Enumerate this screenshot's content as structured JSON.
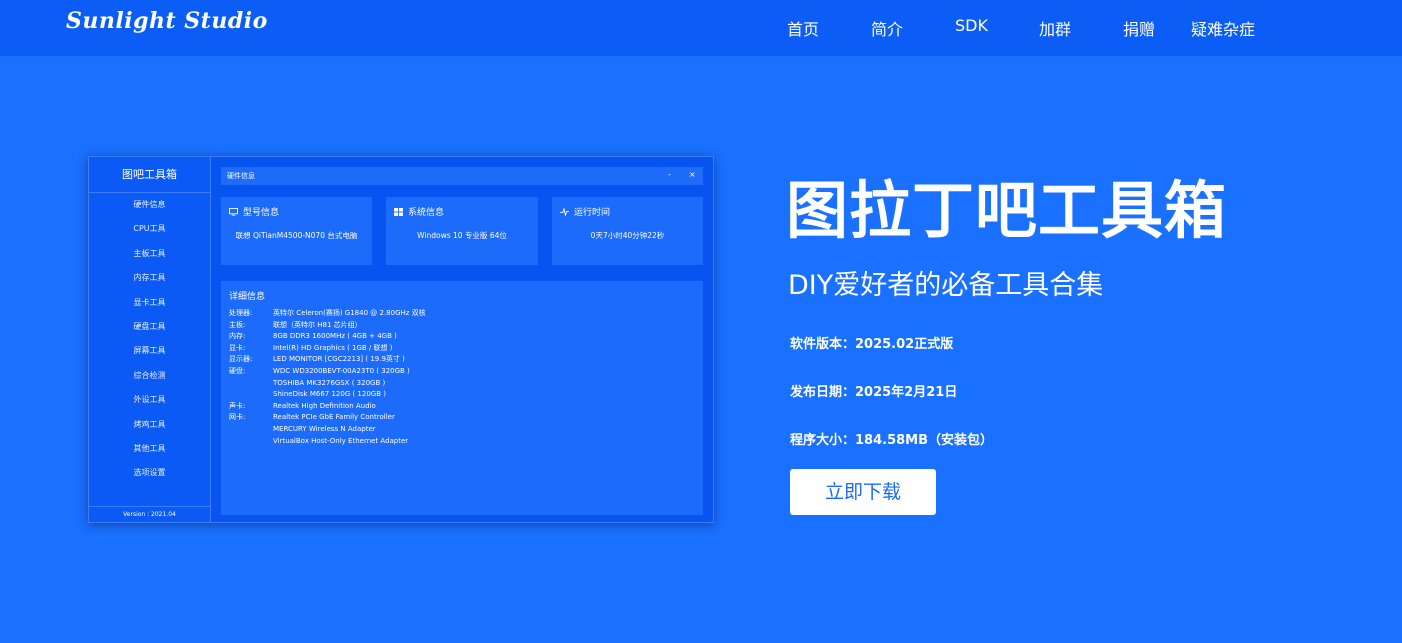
{
  "header": {
    "logo": "Sunlight Studio",
    "nav": [
      "首页",
      "简介",
      "SDK",
      "加群",
      "捐赠",
      "疑难杂症"
    ]
  },
  "app": {
    "side_title": "图吧工具箱",
    "side_items": [
      "硬件信息",
      "CPU工具",
      "主板工具",
      "内存工具",
      "显卡工具",
      "硬盘工具",
      "屏幕工具",
      "综合检测",
      "外设工具",
      "烤鸡工具",
      "其他工具",
      "选项设置"
    ],
    "version": "Version : 2021.04",
    "window_title": "硬件信息",
    "win_min": "-",
    "win_close": "×",
    "cards": [
      {
        "title": "型号信息",
        "value": "联想 QiTianM4500-N070 台式电脑",
        "icon": "monitor-icon"
      },
      {
        "title": "系统信息",
        "value": "Windows 10 专业版 64位",
        "icon": "windows-icon"
      },
      {
        "title": "运行时间",
        "value": "0天7小时40分钟22秒",
        "icon": "pulse-icon"
      }
    ],
    "detail_title": "详细信息",
    "detail_rows": [
      {
        "k": "处理器:",
        "v": "英特尔 Celeron(赛扬) G1840 @ 2.80GHz 双核"
      },
      {
        "k": "主板:",
        "v": "联想（英特尔 H81 芯片组）"
      },
      {
        "k": "内存:",
        "v": "8GB DDR3 1600MHz ( 4GB + 4GB )"
      },
      {
        "k": "显卡:",
        "v": "Intel(R) HD Graphics ( 1GB / 联想 )"
      },
      {
        "k": "显示器:",
        "v": "LED MONITOR [CGC2213] ( 19.9英寸 )"
      },
      {
        "k": "硬盘:",
        "v": "WDC WD3200BEVT-00A23T0 ( 320GB )"
      },
      {
        "k": "",
        "v": "TOSHIBA MK3276GSX ( 320GB )"
      },
      {
        "k": "",
        "v": "ShineDisk M667 120G ( 120GB )"
      },
      {
        "k": "声卡:",
        "v": "Realtek High Definition Audio"
      },
      {
        "k": "网卡:",
        "v": "Realtek PCIe GbE Family Controller"
      },
      {
        "k": "",
        "v": "MERCURY Wireless N Adapter"
      },
      {
        "k": "",
        "v": "VirtualBox Host-Only Ethernet Adapter"
      }
    ]
  },
  "hero": {
    "title": "图拉丁吧工具箱",
    "subtitle": "DIY爱好者的必备工具合集",
    "version": "软件版本：2025.02正式版",
    "date": "发布日期：2025年2月21日",
    "size": "程序大小：184.58MB（安装包）",
    "download": "立即下载"
  },
  "colors": {
    "background": "#1a70ff",
    "header": "#0b5df5",
    "app_bg": "#0854f0",
    "button_text": "#1a6cf6"
  }
}
